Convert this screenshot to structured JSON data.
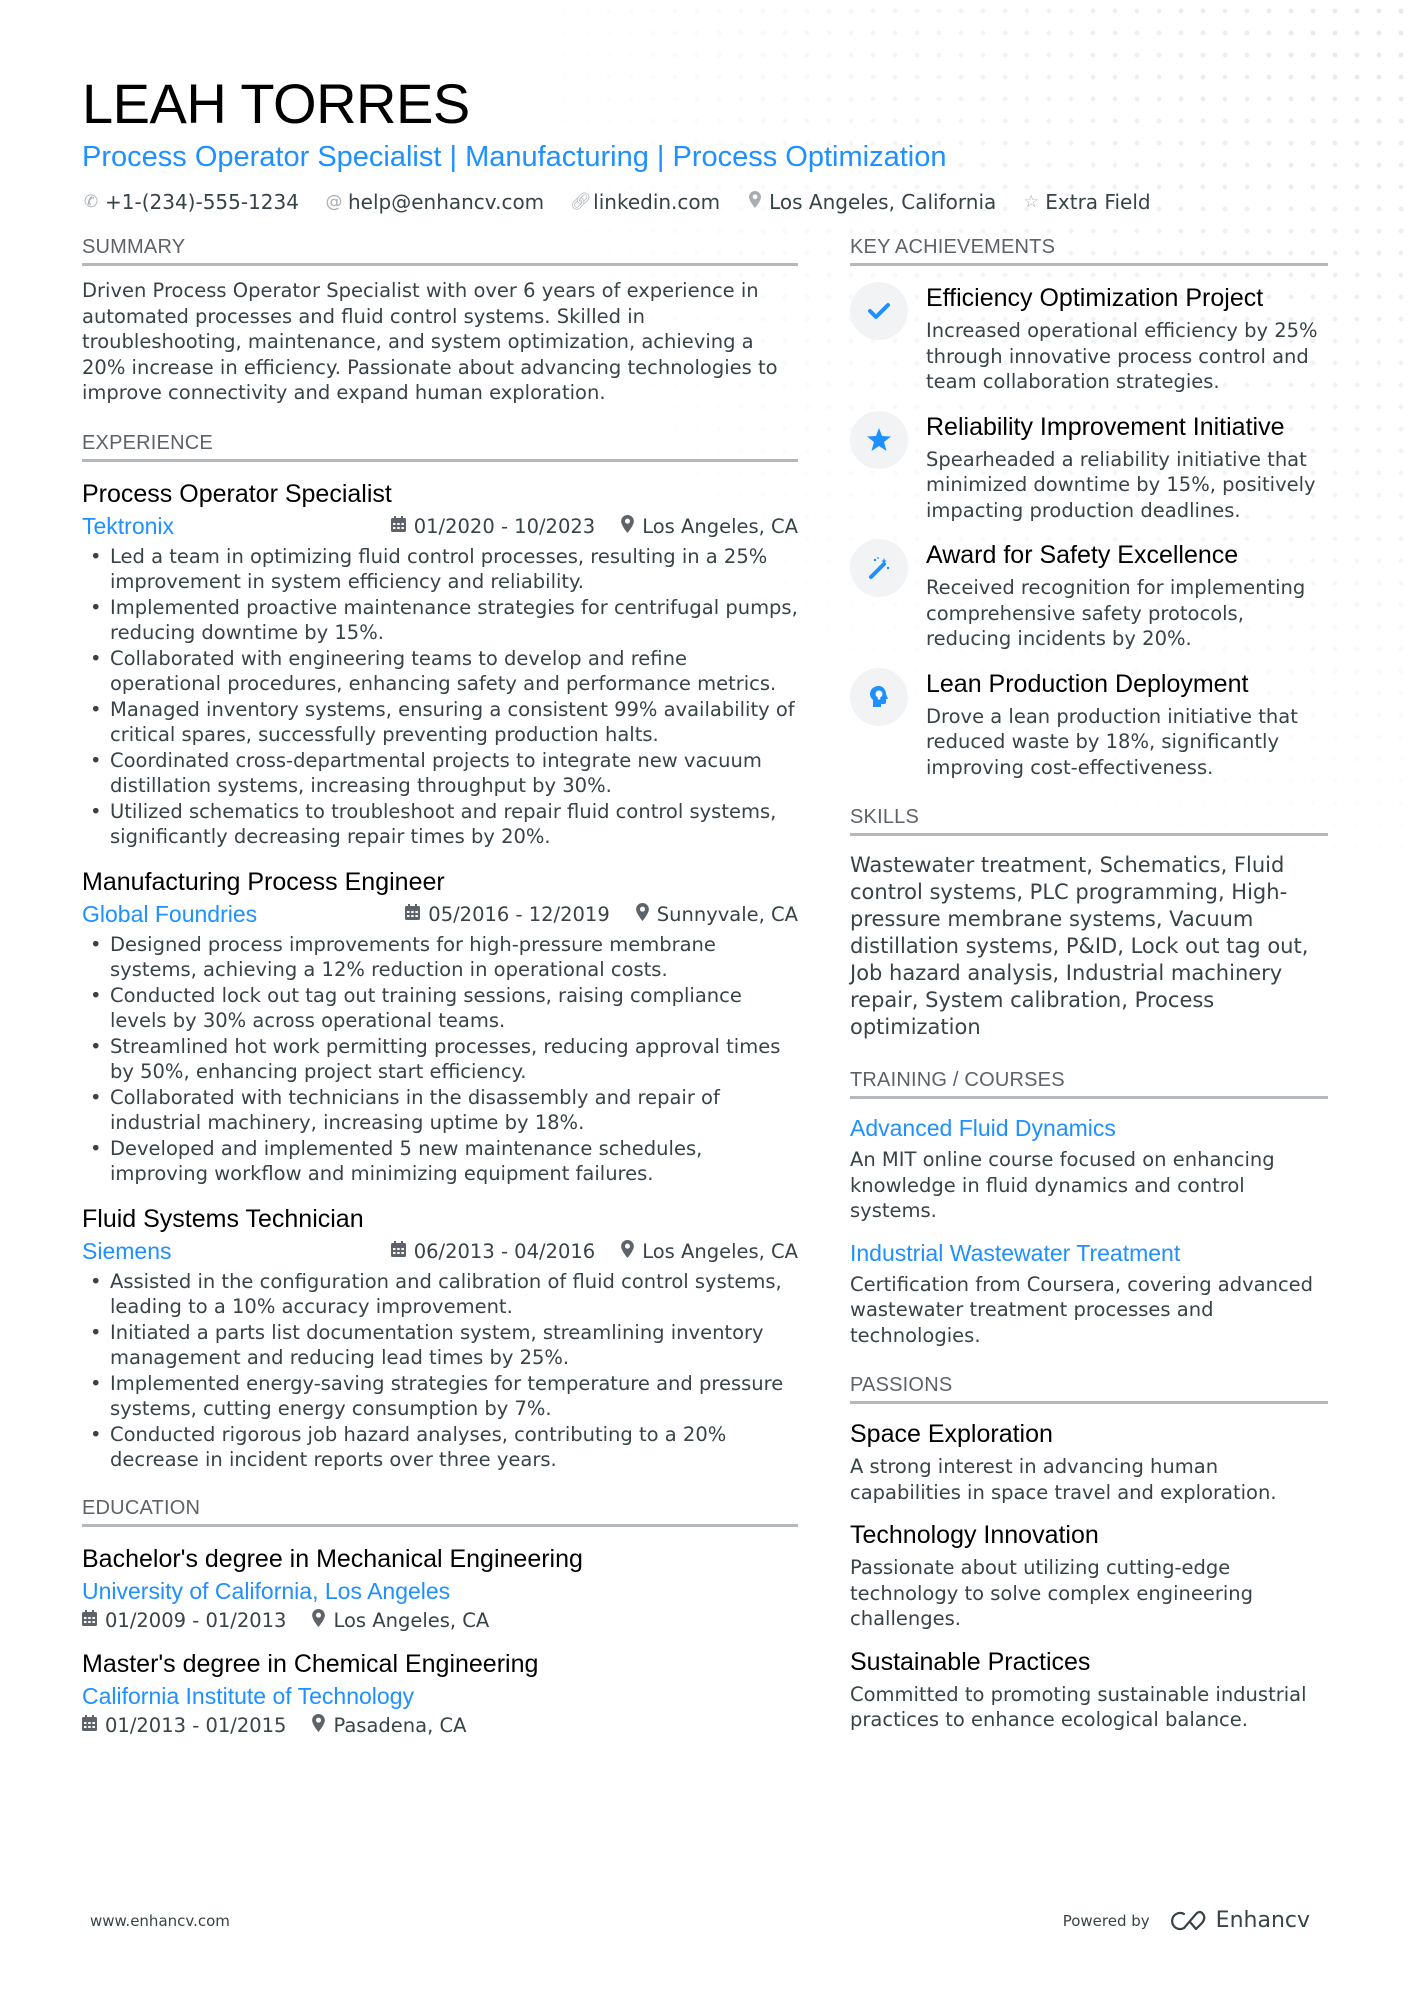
{
  "header": {
    "name": "LEAH TORRES",
    "headline": "Process Operator Specialist | Manufacturing | Process Optimization",
    "contacts": [
      {
        "icon": "phone-icon",
        "text": "+1-(234)-555-1234"
      },
      {
        "icon": "at-icon",
        "text": "help@enhancv.com"
      },
      {
        "icon": "link-icon",
        "text": "linkedin.com"
      },
      {
        "icon": "location-icon",
        "text": "Los Angeles, California"
      },
      {
        "icon": "star-icon",
        "text": "Extra Field"
      }
    ]
  },
  "colors": {
    "accent": "#1e90ff",
    "text": "#384347",
    "heading": "#000000",
    "rule": "#b5b8bc"
  },
  "summary": {
    "title": "Summary",
    "text": "Driven Process Operator Specialist with over 6 years of experience in automated processes and fluid control systems. Skilled in troubleshooting, maintenance, and system optimization, achieving a 20% increase in efficiency. Passionate about advancing technologies to improve connectivity and expand human exploration."
  },
  "experience": {
    "title": "Experience",
    "jobs": [
      {
        "title": "Process Operator Specialist",
        "company": "Tektronix",
        "dates": "01/2020 - 10/2023",
        "location": "Los Angeles, CA",
        "bullets": [
          "Led a team in optimizing fluid control processes, resulting in a 25% improvement in system efficiency and reliability.",
          "Implemented proactive maintenance strategies for centrifugal pumps, reducing downtime by 15%.",
          "Collaborated with engineering teams to develop and refine operational procedures, enhancing safety and performance metrics.",
          "Managed inventory systems, ensuring a consistent 99% availability of critical spares, successfully preventing production halts.",
          "Coordinated cross-departmental projects to integrate new vacuum distillation systems, increasing throughput by 30%.",
          "Utilized schematics to troubleshoot and repair fluid control systems, significantly decreasing repair times by 20%."
        ]
      },
      {
        "title": "Manufacturing Process Engineer",
        "company": "Global Foundries",
        "dates": "05/2016 - 12/2019",
        "location": "Sunnyvale, CA",
        "bullets": [
          "Designed process improvements for high-pressure membrane systems, achieving a 12% reduction in operational costs.",
          "Conducted lock out tag out training sessions, raising compliance levels by 30% across operational teams.",
          "Streamlined hot work permitting processes, reducing approval times by 50%, enhancing project start efficiency.",
          "Collaborated with technicians in the disassembly and repair of industrial machinery, increasing uptime by 18%.",
          "Developed and implemented 5 new maintenance schedules, improving workflow and minimizing equipment failures."
        ]
      },
      {
        "title": "Fluid Systems Technician",
        "company": "Siemens",
        "dates": "06/2013 - 04/2016",
        "location": "Los Angeles, CA",
        "bullets": [
          "Assisted in the configuration and calibration of fluid control systems, leading to a 10% accuracy improvement.",
          "Initiated a parts list documentation system, streamlining inventory management and reducing lead times by 25%.",
          "Implemented energy-saving strategies for temperature and pressure systems, cutting energy consumption by 7%.",
          "Conducted rigorous job hazard analyses, contributing to a 20% decrease in incident reports over three years."
        ]
      }
    ]
  },
  "education": {
    "title": "Education",
    "items": [
      {
        "degree": "Bachelor's degree in Mechanical Engineering",
        "school": "University of California, Los Angeles",
        "dates": "01/2009 - 01/2013",
        "location": "Los Angeles, CA"
      },
      {
        "degree": "Master's degree in Chemical Engineering",
        "school": "California Institute of Technology",
        "dates": "01/2013 - 01/2015",
        "location": "Pasadena, CA"
      }
    ]
  },
  "achievements": {
    "title": "Key Achievements",
    "items": [
      {
        "icon": "check-icon",
        "title": "Efficiency Optimization Project",
        "desc": "Increased operational efficiency by 25% through innovative process control and team collaboration strategies."
      },
      {
        "icon": "star-icon",
        "title": "Reliability Improvement Initiative",
        "desc": "Spearheaded a reliability initiative that minimized downtime by 15%, positively impacting production deadlines."
      },
      {
        "icon": "magic-wand-icon",
        "title": "Award for Safety Excellence",
        "desc": "Received recognition for implementing comprehensive safety protocols, reducing incidents by 20%."
      },
      {
        "icon": "head-lightbulb-icon",
        "title": "Lean Production Deployment",
        "desc": "Drove a lean production initiative that reduced waste by 18%, significantly improving cost-effectiveness."
      }
    ]
  },
  "skills": {
    "title": "Skills",
    "text": "Wastewater treatment, Schematics, Fluid control systems, PLC programming, High-pressure membrane systems, Vacuum distillation systems, P&ID, Lock out tag out, Job hazard analysis, Industrial machinery repair, System calibration, Process optimization"
  },
  "training": {
    "title": "Training / Courses",
    "items": [
      {
        "title": "Advanced Fluid Dynamics",
        "desc": "An MIT online course focused on enhancing knowledge in fluid dynamics and control systems."
      },
      {
        "title": "Industrial Wastewater Treatment",
        "desc": "Certification from Coursera, covering advanced wastewater treatment processes and technologies."
      }
    ]
  },
  "passions": {
    "title": "Passions",
    "items": [
      {
        "title": "Space Exploration",
        "desc": "A strong interest in advancing human capabilities in space travel and exploration."
      },
      {
        "title": "Technology Innovation",
        "desc": "Passionate about utilizing cutting-edge technology to solve complex engineering challenges."
      },
      {
        "title": "Sustainable Practices",
        "desc": "Committed to promoting sustainable industrial practices to enhance ecological balance."
      }
    ]
  },
  "footer": {
    "url": "www.enhancv.com",
    "powered_by": "Powered by",
    "brand": "Enhancv"
  }
}
